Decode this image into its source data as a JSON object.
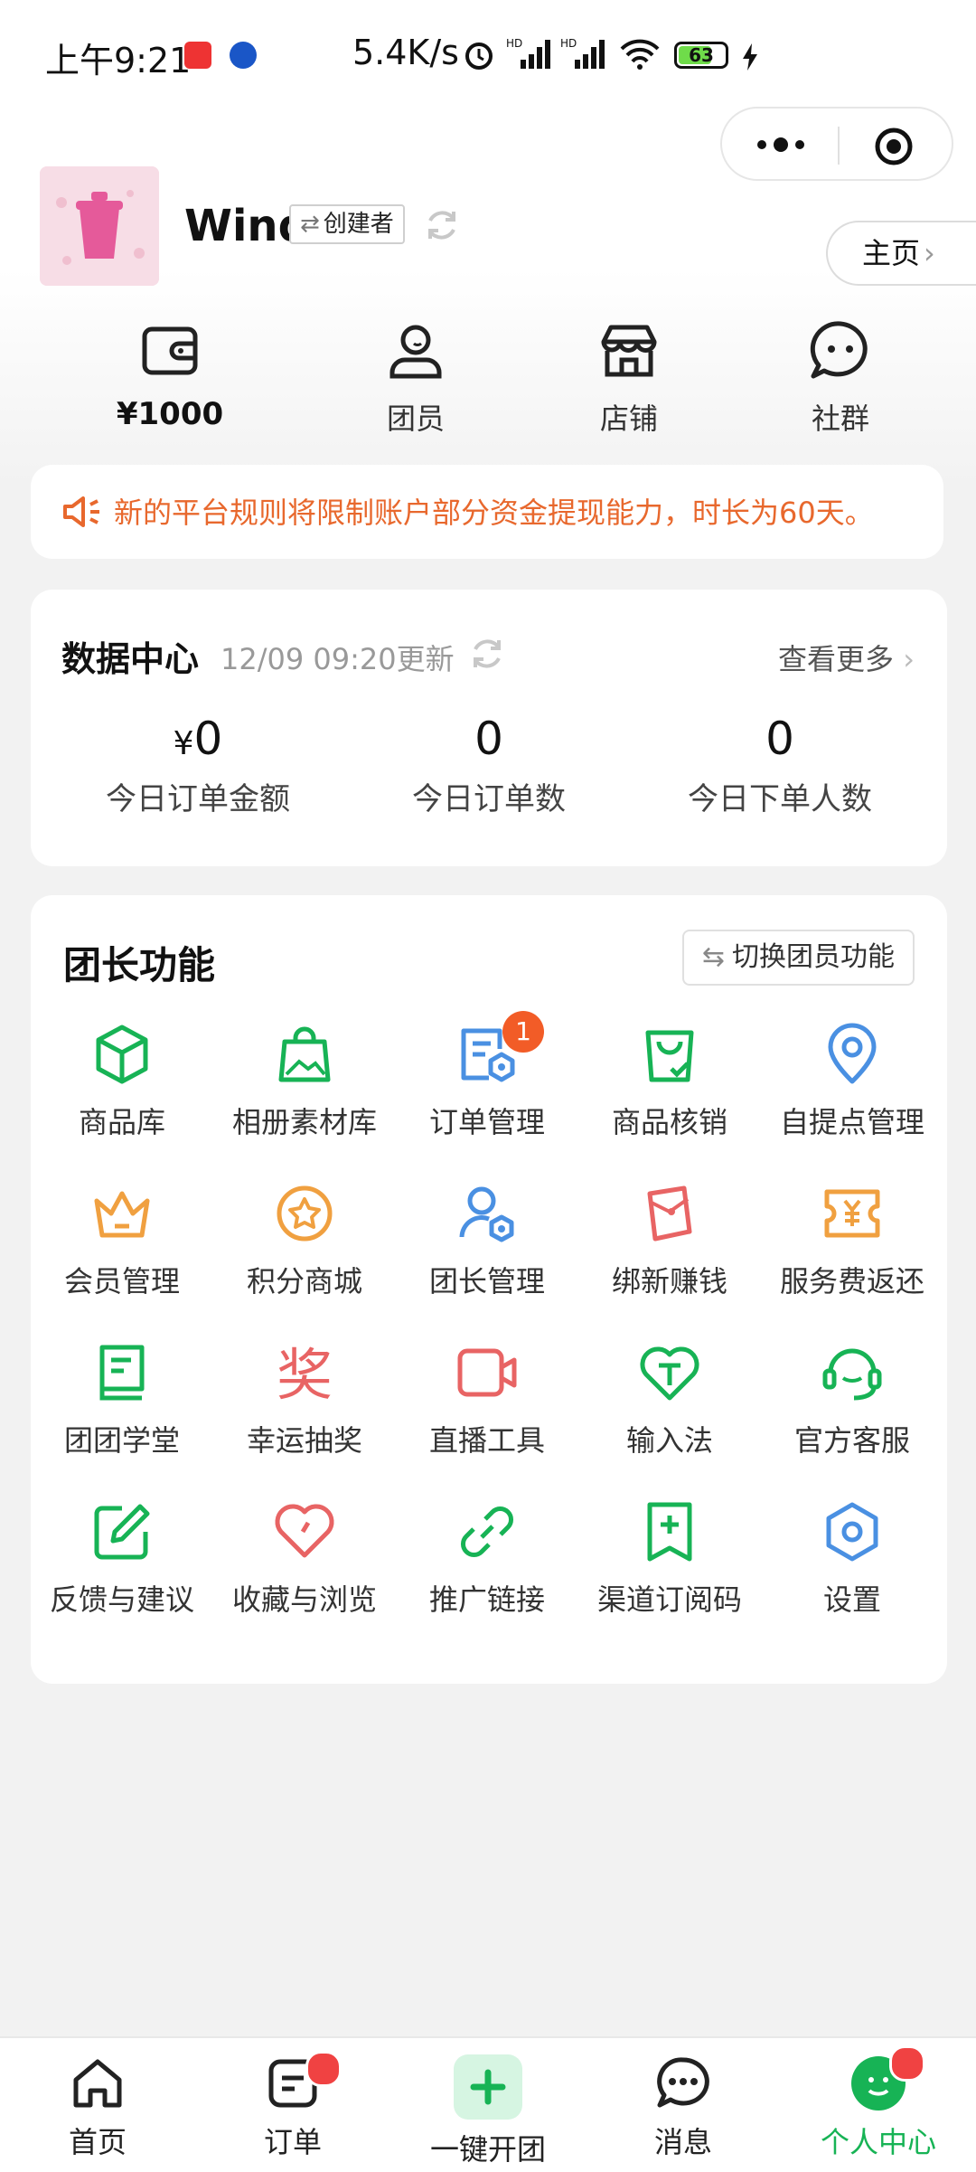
{
  "status_bar": {
    "time": "上午9:21",
    "speed": "5.4K/s",
    "battery": "63"
  },
  "profile": {
    "name": "Wind",
    "role": "创建者",
    "home_label": "主页"
  },
  "quick": [
    {
      "label": "¥1000",
      "icon": "wallet-icon"
    },
    {
      "label": "团员",
      "icon": "member-icon"
    },
    {
      "label": "店铺",
      "icon": "store-icon"
    },
    {
      "label": "社群",
      "icon": "chat-group-icon"
    }
  ],
  "notice": {
    "text": "新的平台规则将限制账户部分资金提现能力，时长为60天。"
  },
  "data_center": {
    "title": "数据中心",
    "update": "12/09 09:20更新",
    "more": "查看更多",
    "stats": [
      {
        "currency": "¥",
        "value": "0",
        "label": "今日订单金额"
      },
      {
        "value": "0",
        "label": "今日订单数"
      },
      {
        "value": "0",
        "label": "今日下单人数"
      }
    ]
  },
  "functions": {
    "title": "团长功能",
    "switch": "切换团员功能",
    "items": [
      {
        "label": "商品库",
        "icon": "cube-icon"
      },
      {
        "label": "相册素材库",
        "icon": "bag-image-icon"
      },
      {
        "label": "订单管理",
        "icon": "order-manage-icon",
        "badge": "1"
      },
      {
        "label": "商品核销",
        "icon": "bag-check-icon"
      },
      {
        "label": "自提点管理",
        "icon": "location-icon"
      },
      {
        "label": "会员管理",
        "icon": "crown-icon"
      },
      {
        "label": "积分商城",
        "icon": "star-coin-icon"
      },
      {
        "label": "团长管理",
        "icon": "leader-icon"
      },
      {
        "label": "绑新赚钱",
        "icon": "red-packet-icon"
      },
      {
        "label": "服务费返还",
        "icon": "yuan-return-icon"
      },
      {
        "label": "团团学堂",
        "icon": "book-icon"
      },
      {
        "label": "幸运抽奖",
        "icon": "prize-char-icon",
        "glyph": "奖"
      },
      {
        "label": "直播工具",
        "icon": "camera-icon"
      },
      {
        "label": "输入法",
        "icon": "heart-t-icon"
      },
      {
        "label": "官方客服",
        "icon": "headset-icon"
      },
      {
        "label": "反馈与建议",
        "icon": "edit-icon"
      },
      {
        "label": "收藏与浏览",
        "icon": "heart-icon"
      },
      {
        "label": "推广链接",
        "icon": "link-icon"
      },
      {
        "label": "渠道订阅码",
        "icon": "bookmark-plus-icon"
      },
      {
        "label": "设置",
        "icon": "hexagon-settings-icon"
      }
    ]
  },
  "tabbar": [
    {
      "label": "首页",
      "icon": "home-icon"
    },
    {
      "label": "订单",
      "icon": "order-icon"
    },
    {
      "label": "一键开团",
      "icon": "plus-icon"
    },
    {
      "label": "消息",
      "icon": "message-icon"
    },
    {
      "label": "个人中心",
      "icon": "profile-icon",
      "active": true
    }
  ],
  "colors": {
    "green": "#17b355",
    "blue": "#4a90e2",
    "orange": "#f0a040",
    "red": "#e86464",
    "notice": "#e8682d"
  }
}
